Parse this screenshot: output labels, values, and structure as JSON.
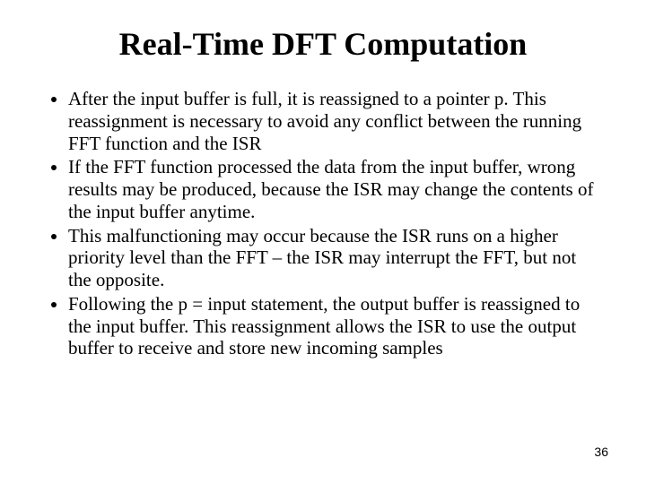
{
  "title": "Real-Time DFT Computation",
  "bullets": [
    "After the input buffer is full, it is reassigned to a pointer p. This reassignment is necessary to avoid any conflict between the running FFT function and the ISR",
    "If the FFT function processed the data from the input buffer, wrong results may be produced, because the ISR may change the contents of the input buffer anytime.",
    "This malfunctioning may occur because the ISR runs on a higher priority level than the FFT – the ISR may interrupt the FFT, but not the opposite.",
    "Following the p = input statement, the output buffer is reassigned to the input buffer. This reassignment allows the ISR to use the output buffer to receive and store new incoming samples"
  ],
  "page_number": "36"
}
